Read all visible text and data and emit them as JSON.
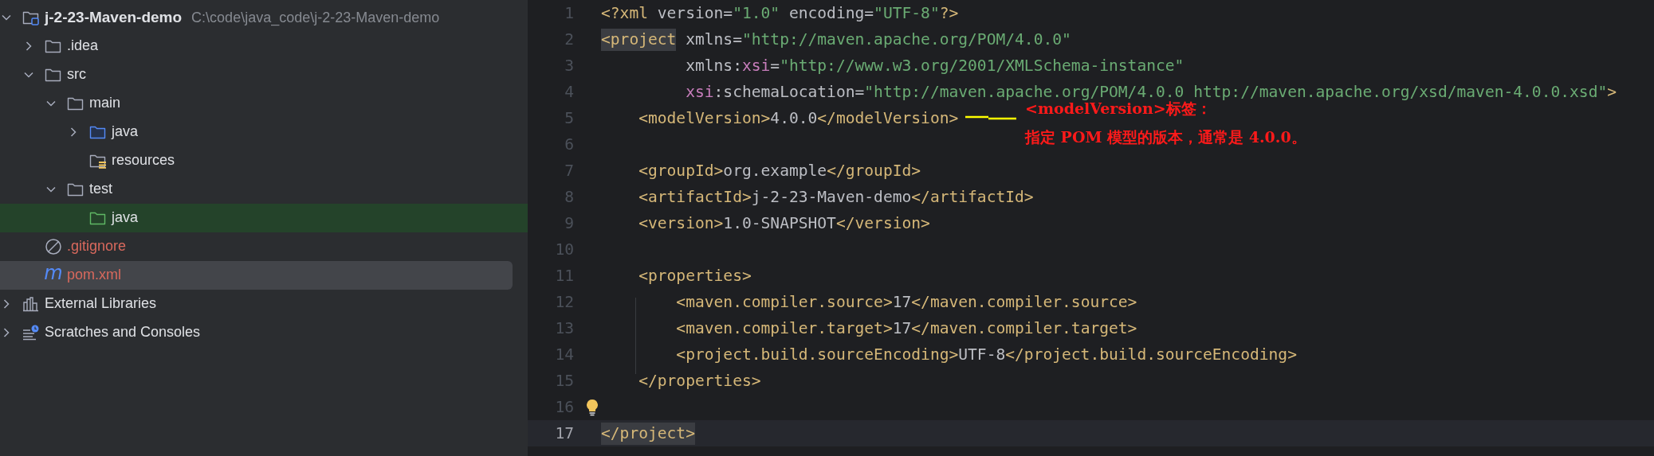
{
  "project_tree": {
    "items": [
      {
        "kind": "project",
        "label": "j-2-23-Maven-demo",
        "path": "C:\\code\\java_code\\j-2-23-Maven-demo",
        "expanded": true,
        "selected": false,
        "highlighted": false,
        "color": "#dfe1e5",
        "children": [
          {
            "kind": "folder",
            "label": ".idea",
            "expanded": false,
            "selected": false,
            "highlighted": false,
            "color": "#dfe1e5"
          },
          {
            "kind": "folder",
            "label": "src",
            "expanded": true,
            "selected": false,
            "highlighted": false,
            "color": "#dfe1e5",
            "children": [
              {
                "kind": "folder",
                "label": "main",
                "expanded": true,
                "selected": false,
                "highlighted": false,
                "color": "#dfe1e5",
                "children": [
                  {
                    "kind": "source-folder",
                    "label": "java",
                    "expanded": false,
                    "selected": false,
                    "highlighted": false,
                    "color": "#dfe1e5"
                  },
                  {
                    "kind": "resource-folder",
                    "label": "resources",
                    "selected": false,
                    "highlighted": false,
                    "color": "#dfe1e5"
                  }
                ]
              },
              {
                "kind": "folder",
                "label": "test",
                "expanded": true,
                "selected": false,
                "highlighted": false,
                "color": "#dfe1e5",
                "children": [
                  {
                    "kind": "test-folder",
                    "label": "java",
                    "selected": false,
                    "highlighted": true,
                    "color": "#dfe1e5"
                  }
                ]
              }
            ]
          },
          {
            "kind": "ignore-file",
            "label": ".gitignore",
            "selected": false,
            "highlighted": false,
            "color": "#d9695d"
          },
          {
            "kind": "maven-file",
            "glyph": "m",
            "label": "pom.xml",
            "selected": true,
            "highlighted": false,
            "color": "#d9695d"
          }
        ]
      },
      {
        "kind": "libraries",
        "label": "External Libraries",
        "expanded": false,
        "selected": false,
        "highlighted": false,
        "color": "#dfe1e5"
      },
      {
        "kind": "scratches",
        "label": "Scratches and Consoles",
        "expanded": false,
        "selected": false,
        "highlighted": false,
        "color": "#dfe1e5"
      }
    ]
  },
  "editor": {
    "lines": [
      {
        "number": "1",
        "current": false,
        "bulb": false,
        "tokens": [
          {
            "text": "<?xml",
            "kind": "tag"
          },
          {
            "text": " version=",
            "kind": "attr"
          },
          {
            "text": "\"1.0\"",
            "kind": "string"
          },
          {
            "text": " encoding=",
            "kind": "attr"
          },
          {
            "text": "\"UTF-8\"",
            "kind": "string"
          },
          {
            "text": "?>",
            "kind": "tag"
          }
        ]
      },
      {
        "number": "2",
        "current": false,
        "bulb": false,
        "tokens": [
          {
            "text": "<project",
            "kind": "tag",
            "matched": true
          },
          {
            "text": " xmlns=",
            "kind": "attr"
          },
          {
            "text": "\"http://maven.apache.org/POM/4.0.0\"",
            "kind": "string"
          }
        ]
      },
      {
        "number": "3",
        "current": false,
        "bulb": false,
        "tokens": [
          {
            "text": "         xmlns:",
            "kind": "attr"
          },
          {
            "text": "xsi",
            "kind": "ns"
          },
          {
            "text": "=",
            "kind": "attr"
          },
          {
            "text": "\"http://www.w3.org/2001/XMLSchema-instance\"",
            "kind": "string"
          }
        ]
      },
      {
        "number": "4",
        "current": false,
        "bulb": false,
        "tokens": [
          {
            "text": "         xsi",
            "kind": "ns"
          },
          {
            "text": ":schemaLocation=",
            "kind": "attr"
          },
          {
            "text": "\"http://maven.apache.org/POM/4.0.0 http://maven.apache.org/xsd/maven-4.0.0.xsd\"",
            "kind": "string"
          },
          {
            "text": ">",
            "kind": "tag"
          }
        ]
      },
      {
        "number": "5",
        "current": false,
        "bulb": false,
        "tokens": [
          {
            "text": "    <modelVersion>",
            "kind": "tag"
          },
          {
            "text": "4.0.0",
            "kind": "text"
          },
          {
            "text": "</modelVersion>",
            "kind": "tag"
          }
        ]
      },
      {
        "number": "6",
        "current": false,
        "bulb": false
      },
      {
        "number": "7",
        "current": false,
        "bulb": false,
        "tokens": [
          {
            "text": "    <groupId>",
            "kind": "tag"
          },
          {
            "text": "org.example",
            "kind": "text"
          },
          {
            "text": "</groupId>",
            "kind": "tag"
          }
        ]
      },
      {
        "number": "8",
        "current": false,
        "bulb": false,
        "tokens": [
          {
            "text": "    <artifactId>",
            "kind": "tag"
          },
          {
            "text": "j-2-23-Maven-demo",
            "kind": "text"
          },
          {
            "text": "</artifactId>",
            "kind": "tag"
          }
        ]
      },
      {
        "number": "9",
        "current": false,
        "bulb": false,
        "tokens": [
          {
            "text": "    <version>",
            "kind": "tag"
          },
          {
            "text": "1.0-SNAPSHOT",
            "kind": "text"
          },
          {
            "text": "</version>",
            "kind": "tag"
          }
        ]
      },
      {
        "number": "10",
        "current": false,
        "bulb": false
      },
      {
        "number": "11",
        "current": false,
        "bulb": false,
        "tokens": [
          {
            "text": "    <properties>",
            "kind": "tag"
          }
        ]
      },
      {
        "number": "12",
        "current": false,
        "bulb": false,
        "tokens": [
          {
            "text": "        <maven.compiler.source>",
            "kind": "tag"
          },
          {
            "text": "17",
            "kind": "text"
          },
          {
            "text": "</maven.compiler.source>",
            "kind": "tag"
          }
        ]
      },
      {
        "number": "13",
        "current": false,
        "bulb": false,
        "tokens": [
          {
            "text": "        <maven.compiler.target>",
            "kind": "tag"
          },
          {
            "text": "17",
            "kind": "text"
          },
          {
            "text": "</maven.compiler.target>",
            "kind": "tag"
          }
        ]
      },
      {
        "number": "14",
        "current": false,
        "bulb": false,
        "tokens": [
          {
            "text": "        <project.build.sourceEncoding>",
            "kind": "tag"
          },
          {
            "text": "UTF-8",
            "kind": "text"
          },
          {
            "text": "</project.build.sourceEncoding>",
            "kind": "tag"
          }
        ]
      },
      {
        "number": "15",
        "current": false,
        "bulb": false,
        "tokens": [
          {
            "text": "    </properties>",
            "kind": "tag"
          }
        ]
      },
      {
        "number": "16",
        "current": false,
        "bulb": true
      },
      {
        "number": "17",
        "current": true,
        "bulb": false,
        "tokens": [
          {
            "text": "</project>",
            "kind": "tag",
            "matched": true
          }
        ]
      }
    ]
  },
  "annotation": {
    "lines": [
      "<modelVersion>标签：",
      "指定 POM 模型的版本，通常是 4.0.0。"
    ]
  }
}
